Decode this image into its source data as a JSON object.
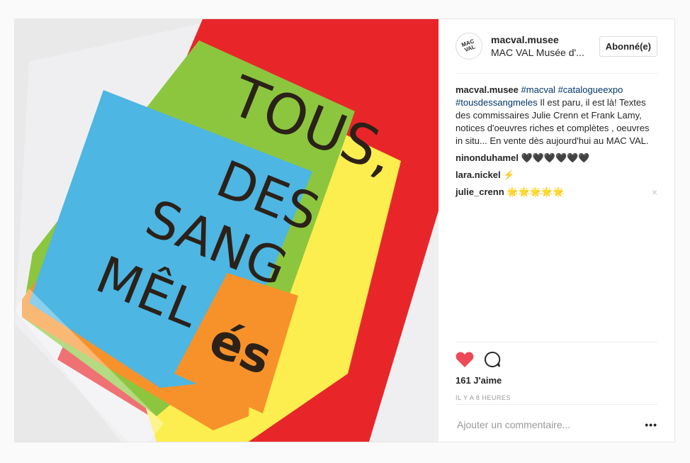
{
  "header": {
    "avatar_line1": "MAC",
    "avatar_line2": "VAL",
    "username": "macval.musee",
    "full_name": "MAC VAL Musée d'...",
    "follow_label": "Abonné(e)"
  },
  "caption": {
    "username": "macval.musee",
    "hashtags": [
      "#macval",
      "#catalogueexpo",
      "#tousdessangmeles"
    ],
    "text": "Il est paru, il est là! Textes des commissaires Julie Crenn et Frank Lamy, notices d'oeuvres riches et complètes , oeuvres in situ... En vente dès aujourd'hui au MAC VAL."
  },
  "comments": [
    {
      "username": "ninonduhamel",
      "text": "🖤🖤🖤🖤🖤🖤"
    },
    {
      "username": "lara.nickel",
      "text": "⚡"
    },
    {
      "username": "julie_crenn",
      "text": "🌟🌟🌟🌟🌟"
    }
  ],
  "comment_close_icon": "×",
  "likes_label": "161 J'aime",
  "timestamp": "IL Y A 8 HEURES",
  "add_comment_placeholder": "Ajouter un commentaire...",
  "more_options": "•••",
  "image": {
    "word1": "TOUS,",
    "word2": "DES",
    "word3": "SANG",
    "word4": "MÊL",
    "word5": "és",
    "colors": {
      "red": "#e8262a",
      "green": "#8cc63f",
      "yellow": "#fcee4f",
      "blue": "#4db6e2",
      "orange": "#f7922b",
      "text": "#2b2119"
    }
  }
}
